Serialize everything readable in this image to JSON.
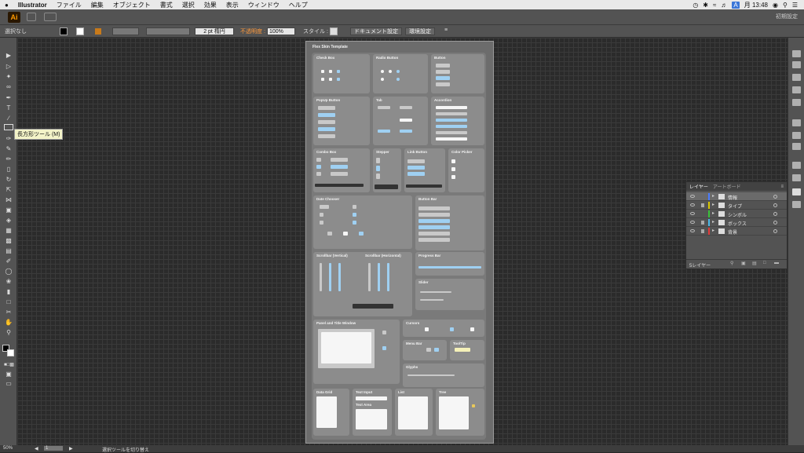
{
  "menubar": {
    "apple": "",
    "app": "Illustrator",
    "items": [
      "ファイル",
      "編集",
      "オブジェクト",
      "書式",
      "選択",
      "効果",
      "表示",
      "ウィンドウ",
      "ヘルプ"
    ],
    "input_indicator": "A",
    "clock": "月 13:48"
  },
  "appbar": {
    "logo": "Ai",
    "workspace": "初期設定"
  },
  "controlbar": {
    "selection": "選択なし",
    "stroke_weight": "2 pt 楕円",
    "opacity_label": "不透明度 :",
    "opacity_value": "100%",
    "style_label": "スタイル :",
    "doc_settings": "ドキュメント設定",
    "preferences": "環境設定"
  },
  "toolbar": {
    "tooltip": "長方形ツール (M)"
  },
  "artboard": {
    "title": "Flex Skin Template",
    "sections": {
      "checkbox": "Check Box",
      "radio": "Radio Button",
      "button": "Button",
      "popup": "PopUp Button",
      "tab": "Tab",
      "accordion": "Accordion",
      "combo": "Combo Box",
      "stepper": "Stepper",
      "link": "Link Button",
      "colorpicker": "Color Picker",
      "date": "Date Chooser",
      "buttonbar": "Button Bar",
      "scroll_v": "Scrollbar (Vertical)",
      "scroll_h": "Scrollbar (Horizontal)",
      "progress": "Progress Bar",
      "slider": "Slider",
      "panel": "Panel and Title Window",
      "cursors": "Cursors",
      "menubar": "Menu Bar",
      "tooltip": "ToolTip",
      "glyphs": "Glyphs",
      "datagrid": "Data Grid",
      "textinput": "Text Input",
      "textarea": "Text Area",
      "list": "List",
      "tree": "Tree"
    }
  },
  "layers": {
    "tabs": [
      "レイヤー",
      "アートボード"
    ],
    "rows": [
      {
        "name": "情報",
        "color": "#4a7cff"
      },
      {
        "name": "タイプ",
        "color": "#d9c800"
      },
      {
        "name": "シンボル",
        "color": "#3ac23a"
      },
      {
        "name": "ボックス",
        "color": "#4ab8e8"
      },
      {
        "name": "背景",
        "color": "#e23a3a"
      }
    ],
    "count": "5レイヤー"
  },
  "statusbar": {
    "zoom": "50%",
    "page": "1",
    "status": "選択ツールを切り替え"
  }
}
